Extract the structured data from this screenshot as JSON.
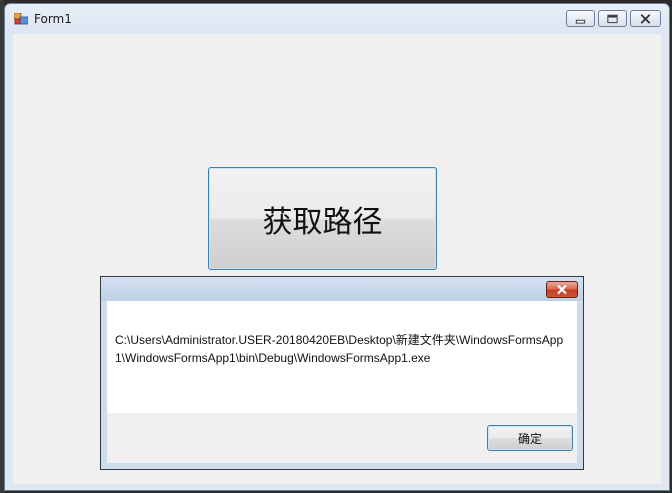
{
  "window": {
    "title": "Form1",
    "icon": "winforms-app-icon",
    "controls": {
      "minimize_icon": "minimize-icon",
      "maximize_icon": "maximize-icon",
      "close_icon": "close-icon"
    }
  },
  "form": {
    "get_path_button_label": "获取路径"
  },
  "messagebox": {
    "title": "",
    "message": "C:\\Users\\Administrator.USER-20180420EB\\Desktop\\新建文件夹\\WindowsFormsApp1\\WindowsFormsApp1\\bin\\Debug\\WindowsFormsApp1.exe",
    "ok_label": "确定",
    "close_icon": "close-icon"
  },
  "colors": {
    "window_frame": "#dfe7f3",
    "client_bg": "#f0f0f0",
    "button_border": "#3c7fb1",
    "close_red": "#c23c22"
  }
}
